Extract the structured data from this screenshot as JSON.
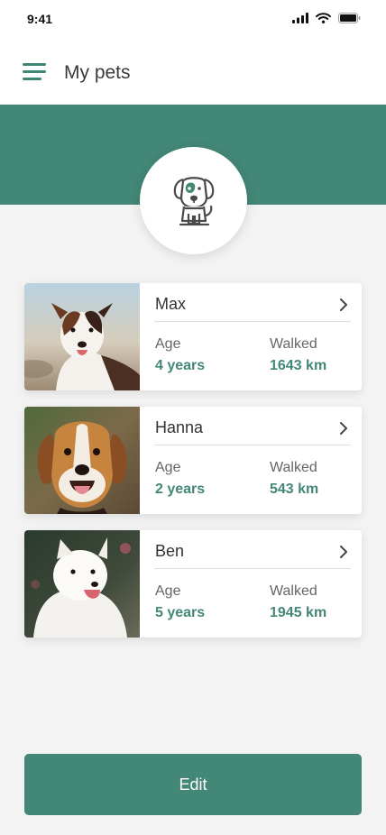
{
  "status_bar": {
    "time": "9:41",
    "icons": [
      "signal-icon",
      "wifi-icon",
      "battery-icon"
    ]
  },
  "header": {
    "title": "My pets",
    "menu_icon": "hamburger-menu-icon"
  },
  "profile": {
    "icon": "dog-icon"
  },
  "pets": [
    {
      "name": "Max",
      "age_label": "Age",
      "age_value": "4 years",
      "walked_label": "Walked",
      "walked_value": "1643 km",
      "photo": "dog-photo-max"
    },
    {
      "name": "Hanna",
      "age_label": "Age",
      "age_value": "2 years",
      "walked_label": "Walked",
      "walked_value": "543 km",
      "photo": "dog-photo-hanna"
    },
    {
      "name": "Ben",
      "age_label": "Age",
      "age_value": "5 years",
      "walked_label": "Walked",
      "walked_value": "1945 km",
      "photo": "dog-photo-ben"
    }
  ],
  "actions": {
    "edit_label": "Edit"
  },
  "colors": {
    "accent": "#438777",
    "background": "#f3f3f3",
    "card": "#ffffff"
  }
}
